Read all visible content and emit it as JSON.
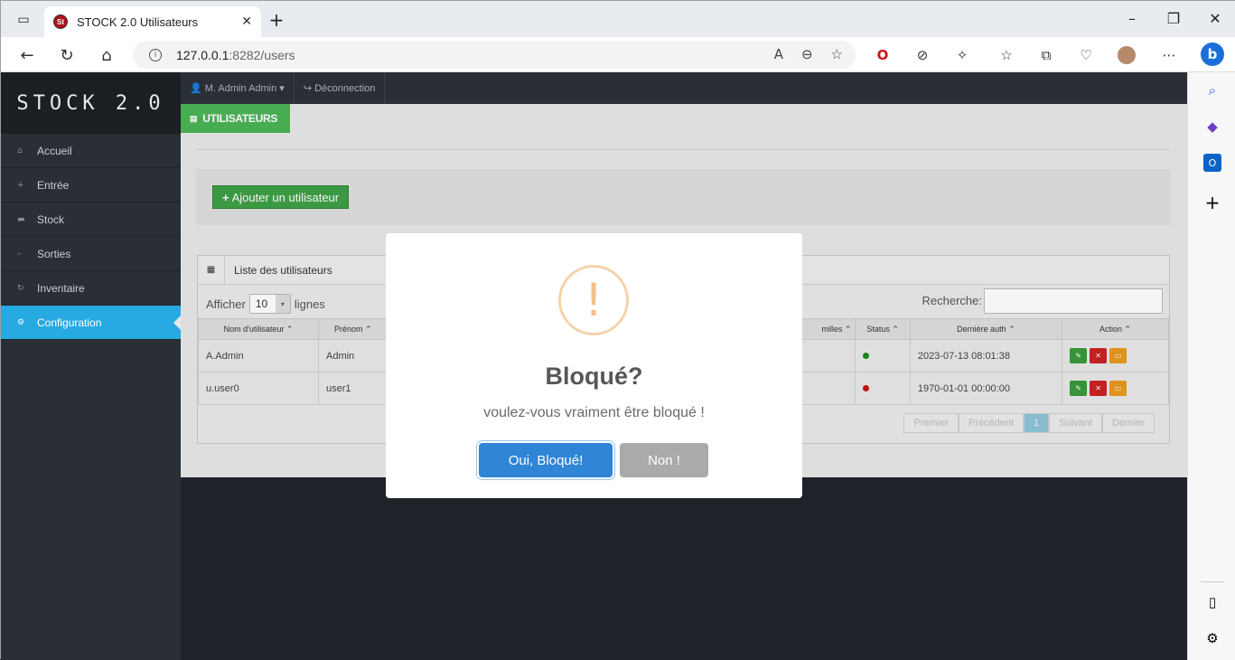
{
  "browser": {
    "tab_title": "STOCK 2.0 Utilisateurs",
    "tab_favicon": "St",
    "url_host": "127.0.0.1",
    "url_rest": ":8282/users"
  },
  "app": {
    "brand": "STOCK 2.0",
    "nav": [
      "Accueil",
      "Entrée",
      "Stock",
      "Sorties",
      "Inventaire",
      "Configuration"
    ],
    "active_nav": "Configuration",
    "topbar_user": "M. Admin Admin",
    "topbar_logout": "Déconnection",
    "page_tab": "UTILISATEURS",
    "add_button": "Ajouter un utilisateur",
    "panel_title": "Liste des utilisateurs",
    "show_prefix": "Afficher",
    "show_value": "10",
    "show_suffix": "lignes",
    "search_label": "Recherche:",
    "columns": [
      "Nom d'utilisateur",
      "Prénom",
      "milles",
      "Status",
      "Dernière auth",
      "Action"
    ],
    "rows": [
      {
        "username": "A.Admin",
        "prenom": "Admin",
        "status_color": "#1a8a1a",
        "last_auth": "2023-07-13 08:01:38"
      },
      {
        "username": "u.user0",
        "prenom": "user1",
        "status_color": "#cc1111",
        "last_auth": "1970-01-01 00:00:00"
      }
    ],
    "pager": [
      "Premier",
      "Précédent",
      "1",
      "Suivant",
      "Dernier"
    ]
  },
  "modal": {
    "icon": "!",
    "title": "Bloqué?",
    "text": "voulez-vous vraiment être bloqué !",
    "confirm": "Oui, Bloqué!",
    "cancel": "Non !"
  }
}
